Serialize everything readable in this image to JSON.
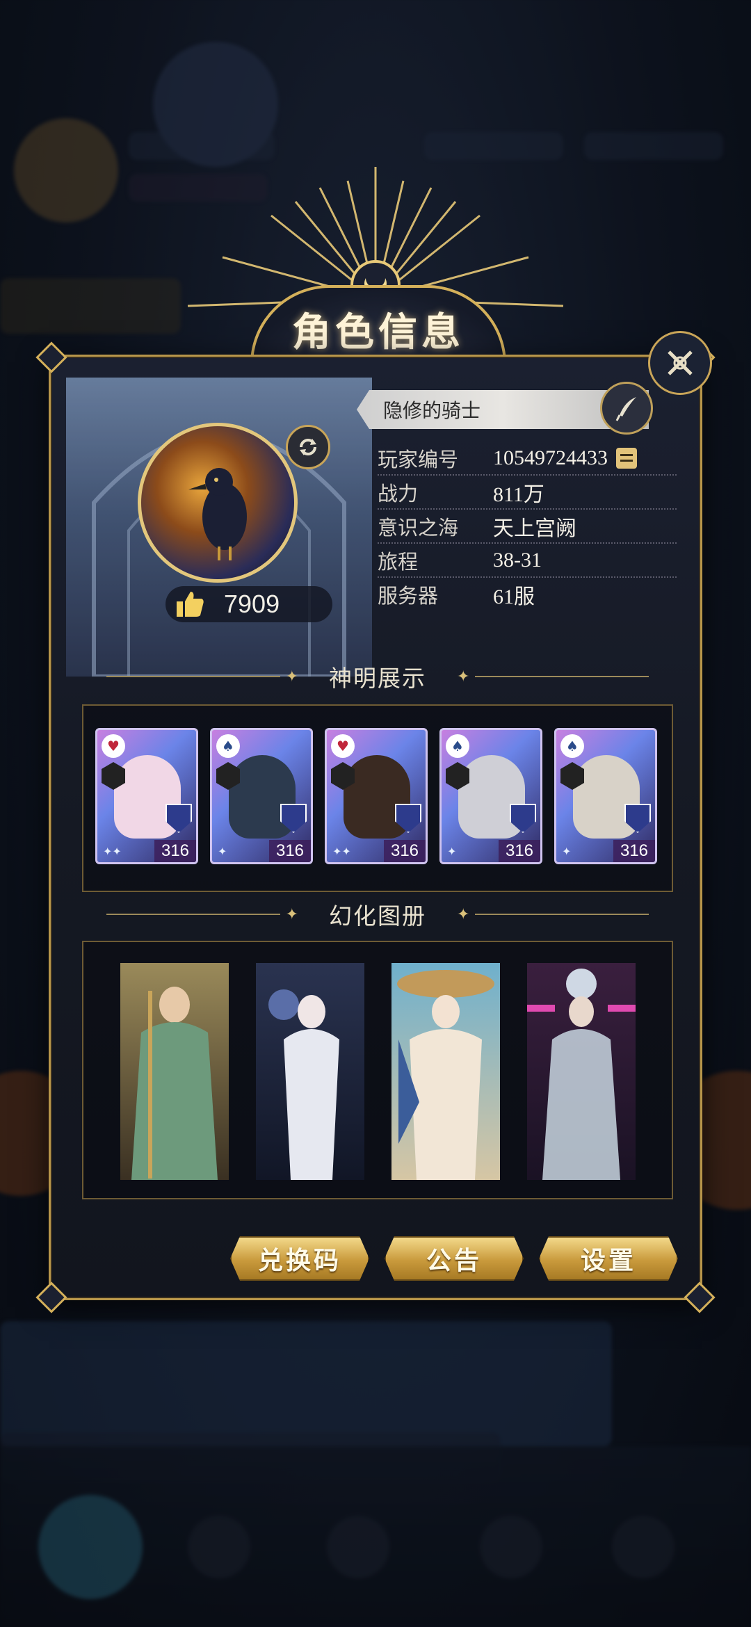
{
  "title": "角色信息",
  "profile": {
    "name": "隐修的骑士",
    "likes": "7909",
    "rows": [
      {
        "label": "玩家编号",
        "value": "10549724433"
      },
      {
        "label": "战力",
        "value": "811万"
      },
      {
        "label": "意识之海",
        "value": "天上宫阙"
      },
      {
        "label": "旅程",
        "value": "38-31"
      },
      {
        "label": "服务器",
        "value": "61服"
      }
    ]
  },
  "gods_section": {
    "heading": "神明展示",
    "cards": [
      {
        "level": "316",
        "rank_icon": "heart-icon",
        "art_color": "#f1d7e6"
      },
      {
        "level": "316",
        "rank_icon": "spade-icon",
        "art_color": "#2c3a4e"
      },
      {
        "level": "316",
        "rank_icon": "heart-icon",
        "art_color": "#3a2a22"
      },
      {
        "level": "316",
        "rank_icon": "spade-icon",
        "art_color": "#cfcfd6"
      },
      {
        "level": "316",
        "rank_icon": "spade-icon",
        "art_color": "#d8d2c8"
      }
    ]
  },
  "skins_section": {
    "heading": "幻化图册",
    "skins": [
      {
        "bg": "#9a8a5a",
        "figure": "#6d9a7c"
      },
      {
        "bg": "#2a3350",
        "figure": "#e6e8f0"
      },
      {
        "bg": "#6fb0cc",
        "figure": "#f2e6d6"
      },
      {
        "bg": "#3a1f3e",
        "figure": "#c8d6e0"
      }
    ]
  },
  "buttons": {
    "redeem": "兑换码",
    "notice": "公告",
    "settings": "设置"
  },
  "colors": {
    "gold": "#d4b05a",
    "panel": "#151923"
  }
}
